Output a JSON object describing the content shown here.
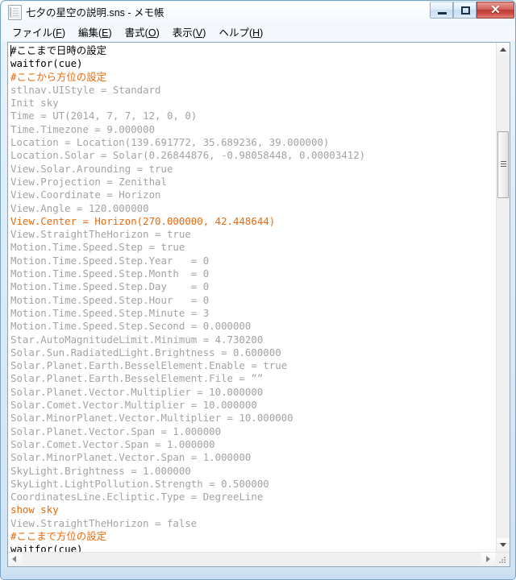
{
  "window": {
    "title": "七夕の星空の説明.sns - メモ帳",
    "icon": "notepad-icon",
    "caption_buttons": {
      "minimize": "–",
      "maximize": "□",
      "close": "✕"
    },
    "colors": {
      "frame": "#cfe3f5",
      "frame_border": "#7aa4c4",
      "close_button": "#bb3a35",
      "comment_text": "#e8690a",
      "command_text": "#a3a3a3",
      "plain_text": "#000000",
      "editor_background": "#ffffff"
    }
  },
  "menubar": {
    "items": [
      {
        "name": "file",
        "label": "ファイル(F)",
        "text_before": "ファイル(",
        "accel": "F",
        "text_after": ")"
      },
      {
        "name": "edit",
        "label": "編集(E)",
        "text_before": "編集(",
        "accel": "E",
        "text_after": ")"
      },
      {
        "name": "format",
        "label": "書式(O)",
        "text_before": "書式(",
        "accel": "O",
        "text_after": ")"
      },
      {
        "name": "view",
        "label": "表示(V)",
        "text_before": "表示(",
        "accel": "V",
        "text_after": ")"
      },
      {
        "name": "help",
        "label": "ヘルプ(H)",
        "text_before": "ヘルプ(",
        "accel": "H",
        "text_after": ")"
      }
    ]
  },
  "editor": {
    "lines": [
      {
        "text": "#ここまで日時の設定",
        "style": "black"
      },
      {
        "text": "waitfor(cue)",
        "style": "black"
      },
      {
        "text": "#ここから方位の設定",
        "style": "orange"
      },
      {
        "text": "stlnav.UIStyle = Standard",
        "style": "grey"
      },
      {
        "text": "Init sky",
        "style": "grey"
      },
      {
        "text": "Time = UT(2014, 7, 7, 12, 0, 0)",
        "style": "grey"
      },
      {
        "text": "Time.Timezone = 9.000000",
        "style": "grey"
      },
      {
        "text": "Location = Location(139.691772, 35.689236, 39.000000)",
        "style": "grey"
      },
      {
        "text": "Location.Solar = Solar(0.26844876, -0.98058448, 0.00003412)",
        "style": "grey"
      },
      {
        "text": "View.Solar.Arounding = true",
        "style": "grey"
      },
      {
        "text": "View.Projection = Zenithal",
        "style": "grey"
      },
      {
        "text": "View.Coordinate = Horizon",
        "style": "grey"
      },
      {
        "text": "View.Angle = 120.000000",
        "style": "grey"
      },
      {
        "text": "View.Center = Horizon(270.000000, 42.448644)",
        "style": "orange"
      },
      {
        "text": "View.StraightTheHorizon = true",
        "style": "grey"
      },
      {
        "text": "Motion.Time.Speed.Step = true",
        "style": "grey"
      },
      {
        "text": "Motion.Time.Speed.Step.Year   = 0",
        "style": "grey"
      },
      {
        "text": "Motion.Time.Speed.Step.Month  = 0",
        "style": "grey"
      },
      {
        "text": "Motion.Time.Speed.Step.Day    = 0",
        "style": "grey"
      },
      {
        "text": "Motion.Time.Speed.Step.Hour   = 0",
        "style": "grey"
      },
      {
        "text": "Motion.Time.Speed.Step.Minute = 3",
        "style": "grey"
      },
      {
        "text": "Motion.Time.Speed.Step.Second = 0.000000",
        "style": "grey"
      },
      {
        "text": "Star.AutoMagnitudeLimit.Minimum = 4.730200",
        "style": "grey"
      },
      {
        "text": "Solar.Sun.RadiatedLight.Brightness = 0.600000",
        "style": "grey"
      },
      {
        "text": "Solar.Planet.Earth.BesselElement.Enable = true",
        "style": "grey"
      },
      {
        "text": "Solar.Planet.Earth.BesselElement.File = ””",
        "style": "grey"
      },
      {
        "text": "Solar.Planet.Vector.Multiplier = 10.000000",
        "style": "grey"
      },
      {
        "text": "Solar.Comet.Vector.Multiplier = 10.000000",
        "style": "grey"
      },
      {
        "text": "Solar.MinorPlanet.Vector.Multiplier = 10.000000",
        "style": "grey"
      },
      {
        "text": "Solar.Planet.Vector.Span = 1.000000",
        "style": "grey"
      },
      {
        "text": "Solar.Comet.Vector.Span = 1.000000",
        "style": "grey"
      },
      {
        "text": "Solar.MinorPlanet.Vector.Span = 1.000000",
        "style": "grey"
      },
      {
        "text": "SkyLight.Brightness = 1.000000",
        "style": "grey"
      },
      {
        "text": "SkyLight.LightPollution.Strength = 0.500000",
        "style": "grey"
      },
      {
        "text": "CoordinatesLine.Ecliptic.Type = DegreeLine",
        "style": "grey"
      },
      {
        "text": "show sky",
        "style": "orange"
      },
      {
        "text": "View.StraightTheHorizon = false",
        "style": "grey"
      },
      {
        "text": "#ここまで方位の設定",
        "style": "orange"
      },
      {
        "text": "waitfor(cue)",
        "style": "black"
      }
    ]
  },
  "scrollbars": {
    "vertical": {
      "up_arrow": "scroll-up-arrow",
      "down_arrow": "scroll-down-arrow",
      "thumb": "vertical-scroll-thumb"
    },
    "horizontal": {
      "left_arrow": "scroll-left-arrow",
      "right_arrow": "scroll-right-arrow"
    },
    "resize_grip": "resize-grip"
  }
}
